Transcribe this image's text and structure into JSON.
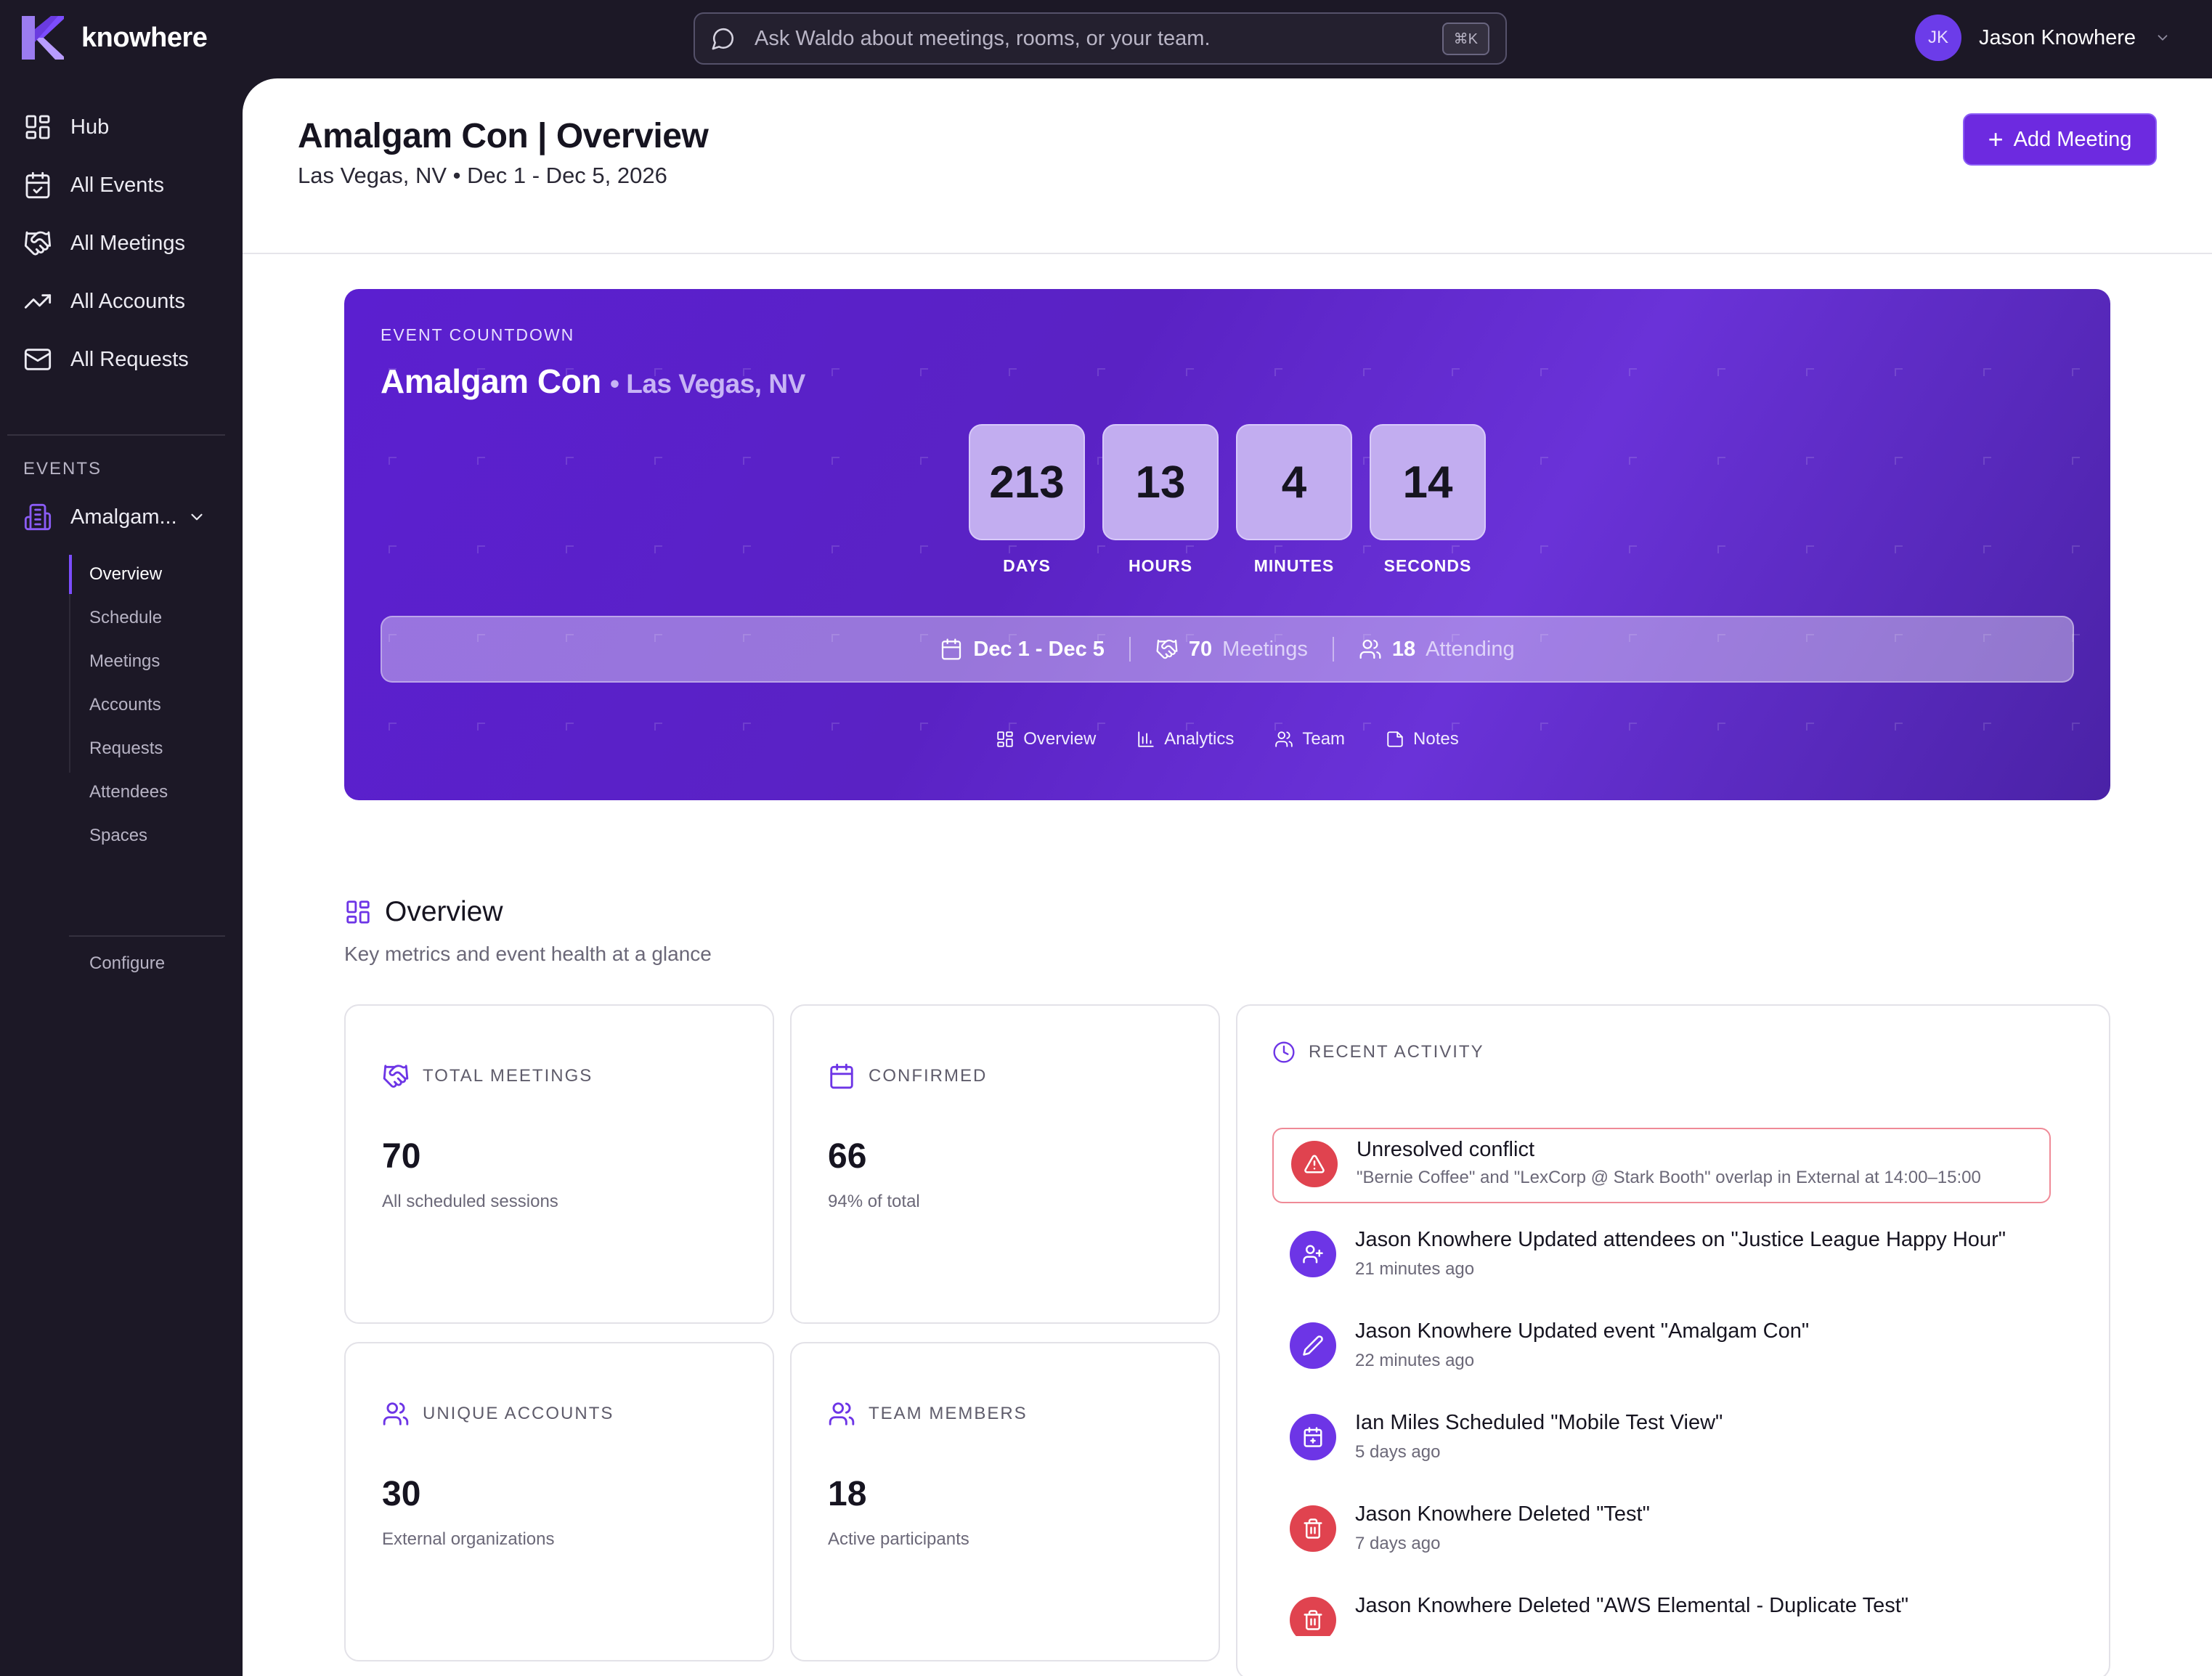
{
  "app": {
    "brand": "knowhere",
    "search_placeholder": "Ask Waldo about meetings, rooms, or your team.",
    "search_shortcut": "⌘K",
    "user_initials": "JK",
    "user_name": "Jason Knowhere"
  },
  "sidebar": {
    "items": [
      {
        "label": "Hub",
        "icon": "grid-icon"
      },
      {
        "label": "All Events",
        "icon": "calendar-icon"
      },
      {
        "label": "All Meetings",
        "icon": "handshake-icon"
      },
      {
        "label": "All Accounts",
        "icon": "trending-up-icon"
      },
      {
        "label": "All Requests",
        "icon": "mail-icon"
      }
    ],
    "events_heading": "EVENTS",
    "event_name": "Amalgam...",
    "subnav": [
      "Overview",
      "Schedule",
      "Meetings",
      "Accounts",
      "Requests",
      "Attendees",
      "Spaces"
    ],
    "active_subnav": "Overview",
    "configure": "Configure"
  },
  "header": {
    "title": "Amalgam Con | Overview",
    "subtitle": "Las Vegas, NV • Dec 1 - Dec 5, 2026",
    "add_button": "Add Meeting"
  },
  "hero": {
    "eyebrow": "EVENT COUNTDOWN",
    "event_name": "Amalgam Con",
    "location": "• Las Vegas, NV",
    "countdown": [
      {
        "value": "213",
        "label": "DAYS"
      },
      {
        "value": "13",
        "label": "HOURS"
      },
      {
        "value": "4",
        "label": "MINUTES"
      },
      {
        "value": "14",
        "label": "SECONDS"
      }
    ],
    "dates": "Dec 1 - Dec 5",
    "meetings_count": "70",
    "meetings_label": "Meetings",
    "attending_count": "18",
    "attending_label": "Attending",
    "tabs": [
      "Overview",
      "Analytics",
      "Team",
      "Notes"
    ]
  },
  "overview": {
    "title": "Overview",
    "subtitle": "Key metrics and event health at a glance",
    "cards": [
      {
        "title": "TOTAL MEETINGS",
        "value": "70",
        "sub": "All scheduled sessions",
        "icon": "handshake-icon"
      },
      {
        "title": "CONFIRMED",
        "value": "66",
        "sub": "94% of total",
        "icon": "calendar-icon"
      },
      {
        "title": "UNIQUE ACCOUNTS",
        "value": "30",
        "sub": "External organizations",
        "icon": "users-icon"
      },
      {
        "title": "TEAM MEMBERS",
        "value": "18",
        "sub": "Active participants",
        "icon": "users-icon"
      }
    ]
  },
  "activity": {
    "title": "RECENT ACTIVITY",
    "items": [
      {
        "actor": "",
        "text": "Unresolved conflict",
        "meta": "\"Bernie Coffee\" and \"LexCorp @ Stark Booth\" overlap in External at 14:00–15:00",
        "icon": "alert-triangle-icon",
        "color": "#e0434f"
      },
      {
        "actor": "Jason Knowhere",
        "text": " Updated attendees on \"Justice League Happy Hour\"",
        "meta": "21 minutes ago",
        "icon": "user-plus-icon",
        "color": "#6d35e6"
      },
      {
        "actor": "Jason Knowhere",
        "text": " Updated event \"Amalgam Con\"",
        "meta": "22 minutes ago",
        "icon": "pencil-icon",
        "color": "#6d35e6"
      },
      {
        "actor": "Ian Miles",
        "text": " Scheduled \"Mobile Test View\"",
        "meta": "5 days ago",
        "icon": "calendar-plus-icon",
        "color": "#6d35e6"
      },
      {
        "actor": "Jason Knowhere",
        "text": " Deleted \"Test\"",
        "meta": "7 days ago",
        "icon": "trash-icon",
        "color": "#e0434f"
      },
      {
        "actor": "Jason Knowhere",
        "text": " Deleted \"AWS Elemental - Duplicate Test\"",
        "meta": "",
        "icon": "trash-icon",
        "color": "#e0434f"
      }
    ]
  },
  "colors": {
    "accent": "#6d2ae0",
    "sidebar_bg": "#1c1826",
    "danger": "#e0434f"
  }
}
